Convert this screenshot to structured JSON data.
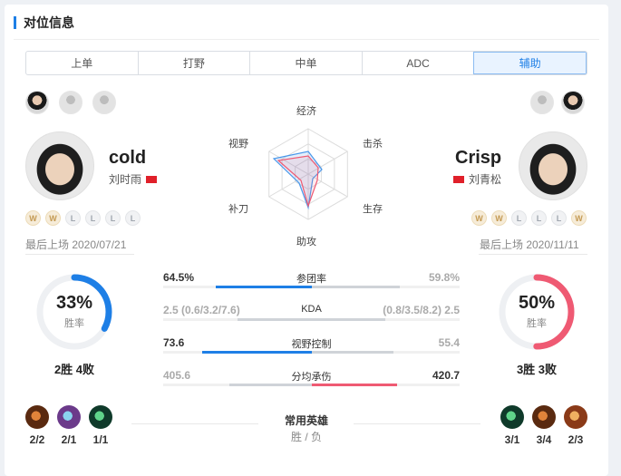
{
  "section": {
    "title": "对位信息"
  },
  "tabs": [
    {
      "label": "上单"
    },
    {
      "label": "打野"
    },
    {
      "label": "中单"
    },
    {
      "label": "ADC"
    },
    {
      "label": "辅助"
    }
  ],
  "active_tab": "辅助",
  "left_player": {
    "name": "cold",
    "cn_name": "刘时雨",
    "results": [
      "W",
      "W",
      "L",
      "L",
      "L",
      "L"
    ],
    "last_played": "最后上场 2020/07/21",
    "winrate": "33%",
    "winrate_value": 33,
    "winrate_label": "胜率",
    "record": "2胜 4败",
    "heroes": [
      {
        "icon": "hero-1-icon",
        "record": "2/2"
      },
      {
        "icon": "hero-2-icon",
        "record": "2/1"
      },
      {
        "icon": "hero-3-icon",
        "record": "1/1"
      }
    ]
  },
  "right_player": {
    "name": "Crisp",
    "cn_name": "刘青松",
    "results": [
      "W",
      "W",
      "L",
      "L",
      "L",
      "W"
    ],
    "last_played": "最后上场 2020/11/11",
    "winrate": "50%",
    "winrate_value": 50,
    "winrate_label": "胜率",
    "record": "3胜 3败",
    "heroes": [
      {
        "icon": "hero-4-icon",
        "record": "3/1"
      },
      {
        "icon": "hero-5-icon",
        "record": "3/4"
      },
      {
        "icon": "hero-6-icon",
        "record": "2/3"
      }
    ]
  },
  "radar": {
    "labels": {
      "top": "经济",
      "top_right": "击杀",
      "bottom_right": "生存",
      "bottom": "助攻",
      "bottom_left": "补刀",
      "top_left": "视野"
    }
  },
  "stats": [
    {
      "name": "参团率",
      "left": "64.5%",
      "right": "59.8%",
      "left_val": 64.5,
      "right_val": 59.8,
      "winner": "left",
      "max": 100
    },
    {
      "name": "KDA",
      "left": "2.5 (0.6/3.2/7.6)",
      "right": "(0.8/3.5/8.2) 2.5",
      "left_val": 2.5,
      "right_val": 2.5,
      "winner": "none",
      "max": 5
    },
    {
      "name": "视野控制",
      "left": "73.6",
      "right": "55.4",
      "left_val": 73.6,
      "right_val": 55.4,
      "winner": "left",
      "max": 100
    },
    {
      "name": "分均承伤",
      "left": "405.6",
      "right": "420.7",
      "left_val": 405.6,
      "right_val": 420.7,
      "winner": "right",
      "max": 730
    }
  ],
  "common_heroes": {
    "title": "常用英雄",
    "sub": "胜 / 负"
  },
  "colors": {
    "accent": "#1e7fe6",
    "red": "#ef5a73",
    "grey_bar": "#cfd3d8"
  }
}
